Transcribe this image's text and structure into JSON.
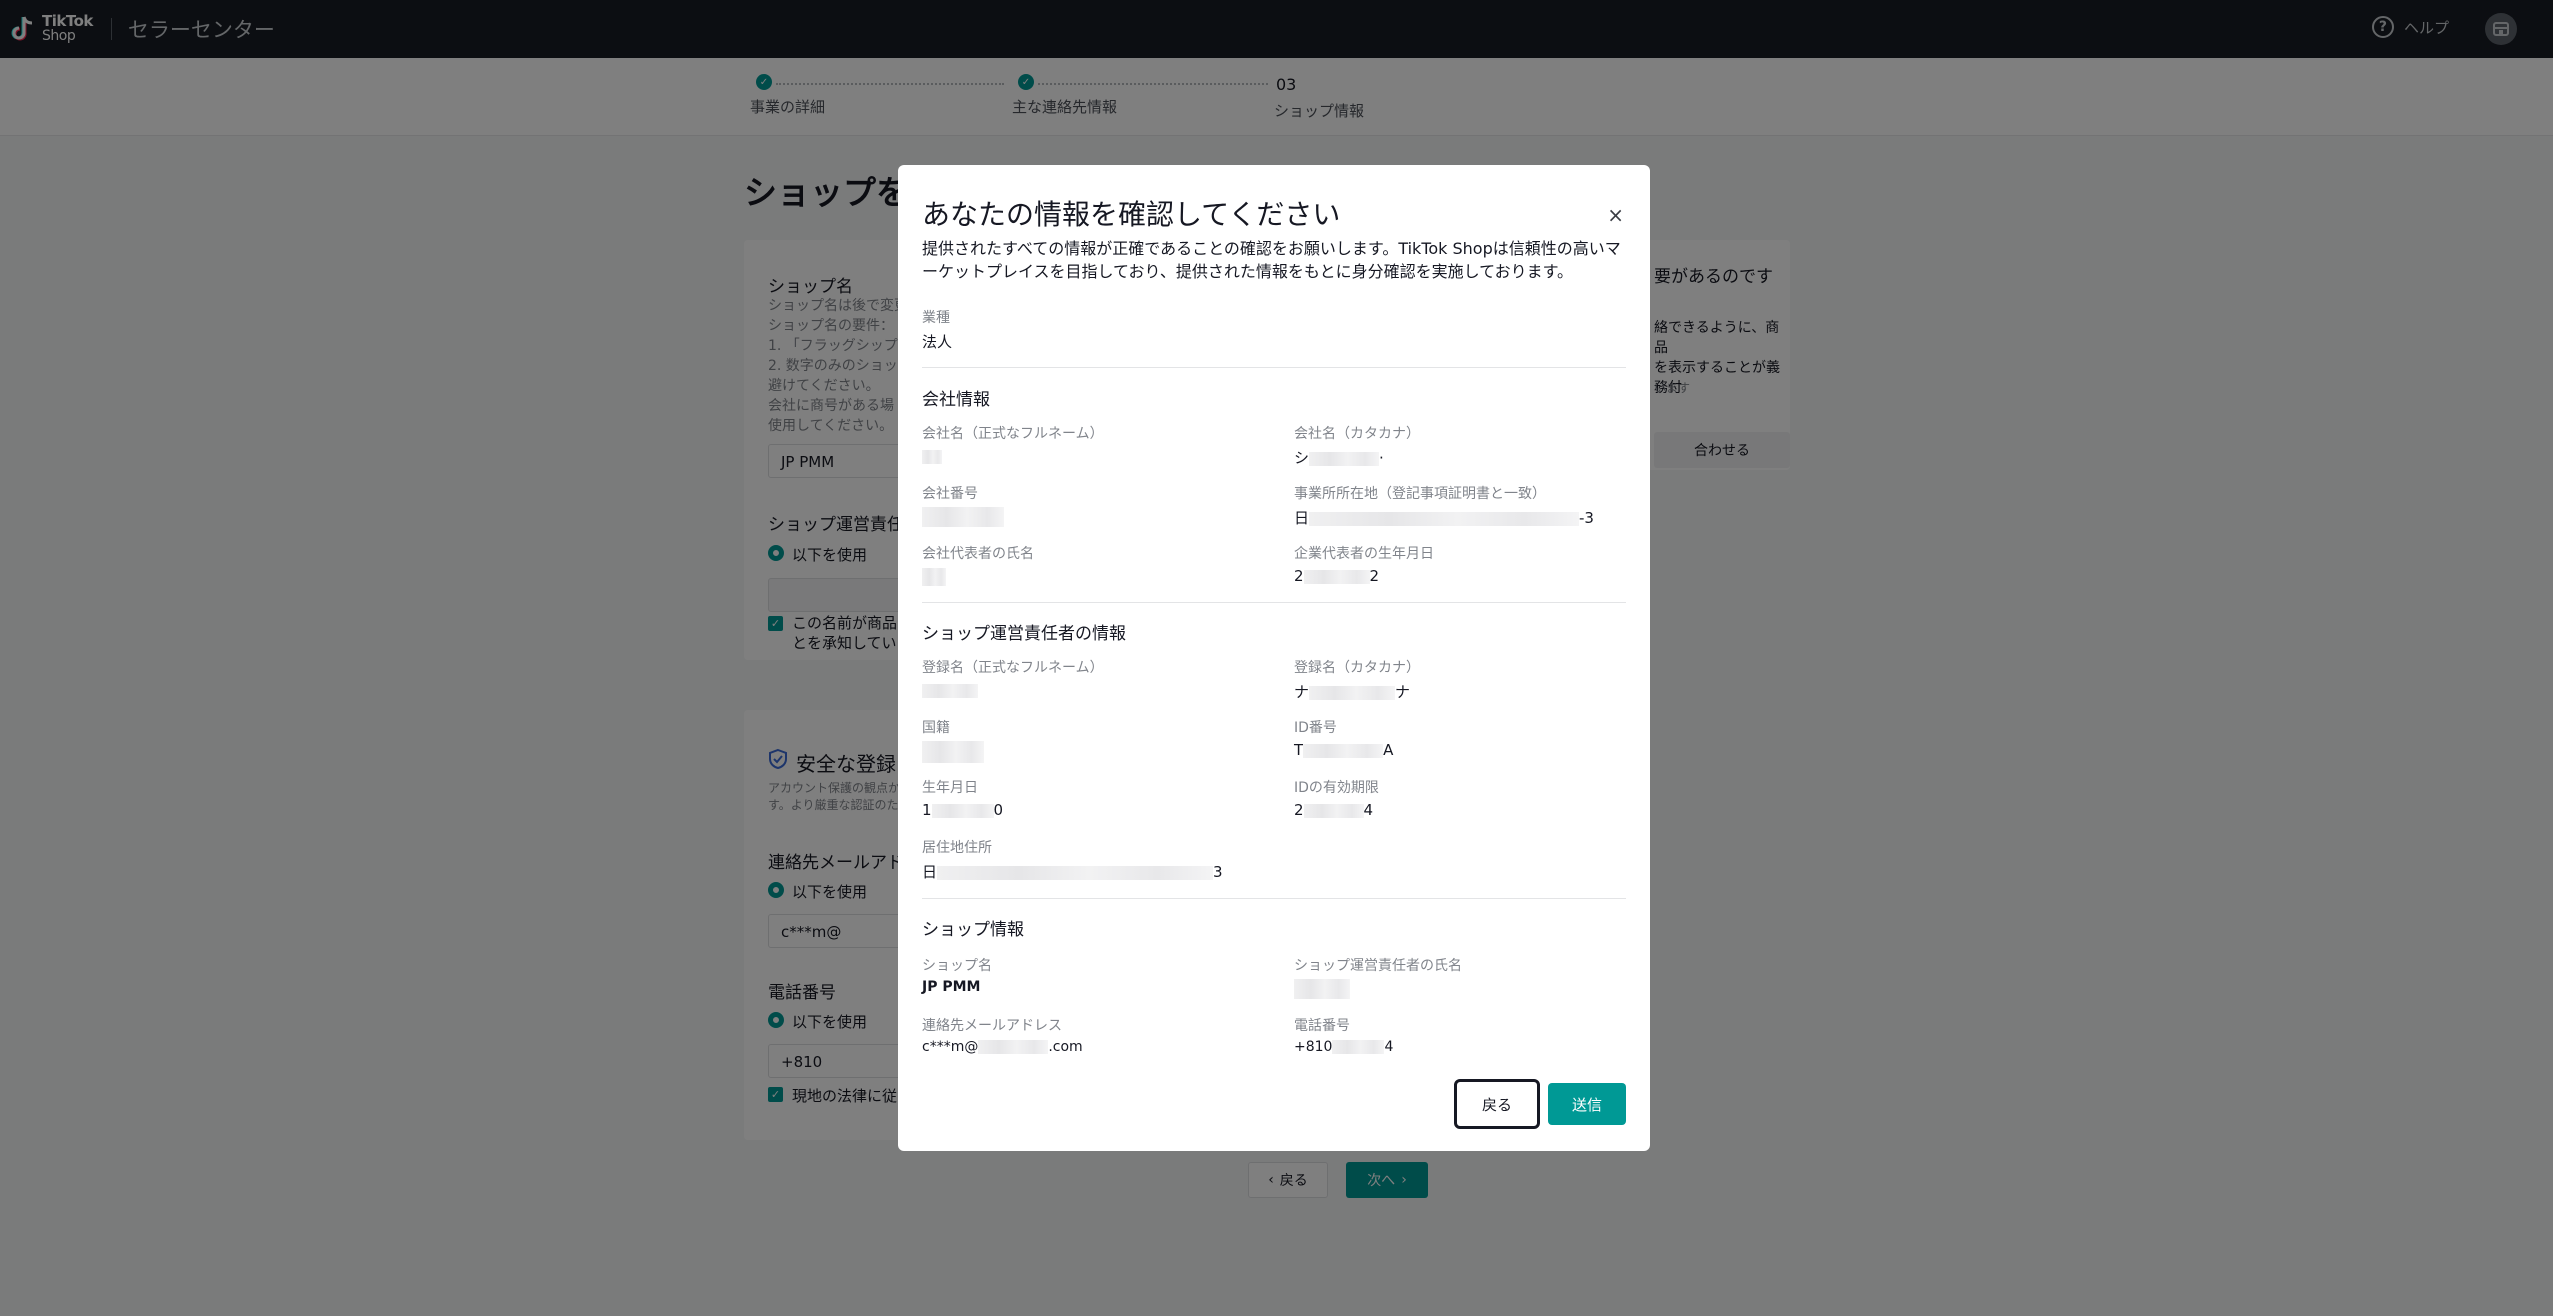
{
  "header": {
    "logo_line1": "TikTok",
    "logo_line2": "Shop",
    "app_title": "セラーセンター",
    "help_label": "ヘルプ",
    "help_glyph": "?"
  },
  "stepper": {
    "steps": [
      {
        "label": "事業の詳細",
        "status": "done"
      },
      {
        "label": "主な連絡先情報",
        "status": "done"
      },
      {
        "number": "03",
        "label": "ショップ情報",
        "status": "current"
      }
    ],
    "check_glyph": "✓"
  },
  "background": {
    "page_title": "ショップを",
    "shop_name_label": "ショップ名",
    "shop_name_help": [
      "ショップ名は後で変更",
      "ショップ名の要件：",
      "1. 「フラッグシップ」",
      "2. 数字のみのショッ",
      "避けてください。",
      "会社に商号がある場",
      "使用してください。"
    ],
    "shop_name_value": "JP PMM",
    "manager_label": "ショップ運営責任",
    "use_following": "以下を使用",
    "manager_confirm": [
      "この名前が商品",
      "とを承知していま"
    ],
    "secure_title": "安全な登録",
    "secure_desc": [
      "アカウント保護の観点か",
      "す。より厳重な認証のた"
    ],
    "email_label": "連絡先メールアド",
    "email_value": "c***m@",
    "phone_label": "電話番号",
    "phone_value": "+810",
    "law_label": "現地の法律に従",
    "side_title": "要があるのです",
    "side_text": [
      "絡できるように、商品",
      "を表示することが義務付"
    ],
    "side_small": "います",
    "side_button": "合わせる",
    "back_button": "戻る",
    "next_button": "次へ"
  },
  "modal": {
    "title": "あなたの情報を確認してください",
    "close_glyph": "×",
    "description": "提供されたすべての情報が正確であることの確認をお願いします。TikTok Shopは信頼性の高いマーケットプレイスを目指しており、提供された情報をもとに身分確認を実施しております。",
    "business_type_label": "業種",
    "business_type_value": "法人",
    "company_section": "会社情報",
    "company_fields": {
      "name_label": "会社名（正式なフルネーム）",
      "kana_label": "会社名（カタカナ）",
      "kana_prefix": "シ",
      "kana_suffix": "·",
      "number_label": "会社番号",
      "address_label": "事業所所在地（登記事項証明書と一致）",
      "address_prefix": "日",
      "address_suffix": "-3",
      "rep_name_label": "会社代表者の氏名",
      "rep_birth_label": "企業代表者の生年月日",
      "rep_birth_prefix": "2",
      "rep_birth_suffix": "2"
    },
    "manager_section": "ショップ運営責任者の情報",
    "manager_fields": {
      "reg_name_label": "登録名（正式なフルネーム）",
      "reg_kana_label": "登録名（カタカナ）",
      "reg_kana_prefix": "ナ",
      "reg_kana_suffix": "ナ",
      "nationality_label": "国籍",
      "id_label": "ID番号",
      "id_prefix": "T",
      "id_suffix": "A",
      "birth_label": "生年月日",
      "birth_prefix": "1",
      "birth_suffix": "0",
      "id_expiry_label": "IDの有効期限",
      "id_expiry_prefix": "2",
      "id_expiry_suffix": "4",
      "address_label": "居住地住所",
      "address_prefix": "日",
      "address_suffix": "3"
    },
    "shop_section": "ショップ情報",
    "shop_fields": {
      "shop_name_label": "ショップ名",
      "shop_name_value": "JP PMM",
      "manager_name_label": "ショップ運営責任者の氏名",
      "email_label": "連絡先メールアドレス",
      "email_prefix": "c***m@",
      "email_suffix": ".com",
      "phone_label": "電話番号",
      "phone_prefix": "+810",
      "phone_suffix": "4"
    },
    "back_button": "戻る",
    "submit_button": "送信"
  }
}
